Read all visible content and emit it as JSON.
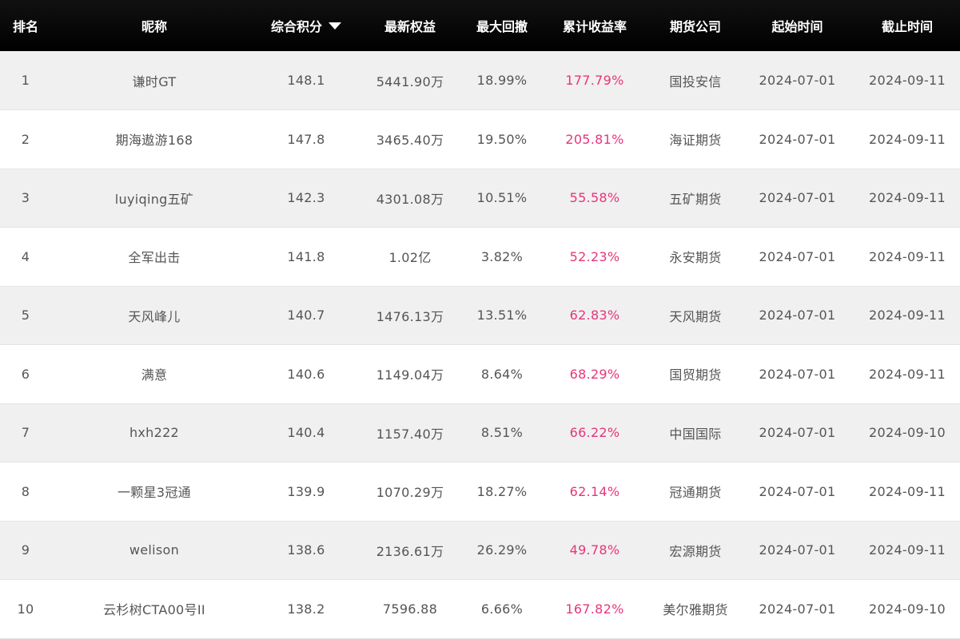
{
  "header": {
    "rank": "排名",
    "nickname": "昵称",
    "score": "综合积分",
    "equity": "最新权益",
    "drawdown": "最大回撤",
    "return": "累计收益率",
    "company": "期货公司",
    "start": "起始时间",
    "end": "截止时间"
  },
  "colors": {
    "header_bg": "#000000",
    "header_text": "#ffffff",
    "row_odd_bg": "#f0f0f0",
    "row_even_bg": "#ffffff",
    "text": "#555555",
    "return_text": "#e8357a"
  },
  "rows": [
    {
      "rank": "1",
      "nickname": "谦时GT",
      "score": "148.1",
      "equity": "5441.90万",
      "drawdown": "18.99%",
      "return": "177.79%",
      "company": "国投安信",
      "start": "2024-07-01",
      "end": "2024-09-11"
    },
    {
      "rank": "2",
      "nickname": "期海遨游168",
      "score": "147.8",
      "equity": "3465.40万",
      "drawdown": "19.50%",
      "return": "205.81%",
      "company": "海证期货",
      "start": "2024-07-01",
      "end": "2024-09-11"
    },
    {
      "rank": "3",
      "nickname": "luyiqing五矿",
      "score": "142.3",
      "equity": "4301.08万",
      "drawdown": "10.51%",
      "return": "55.58%",
      "company": "五矿期货",
      "start": "2024-07-01",
      "end": "2024-09-11"
    },
    {
      "rank": "4",
      "nickname": "全军出击",
      "score": "141.8",
      "equity": "1.02亿",
      "drawdown": "3.82%",
      "return": "52.23%",
      "company": "永安期货",
      "start": "2024-07-01",
      "end": "2024-09-11"
    },
    {
      "rank": "5",
      "nickname": "天风峰儿",
      "score": "140.7",
      "equity": "1476.13万",
      "drawdown": "13.51%",
      "return": "62.83%",
      "company": "天风期货",
      "start": "2024-07-01",
      "end": "2024-09-11"
    },
    {
      "rank": "6",
      "nickname": "满意",
      "score": "140.6",
      "equity": "1149.04万",
      "drawdown": "8.64%",
      "return": "68.29%",
      "company": "国贸期货",
      "start": "2024-07-01",
      "end": "2024-09-11"
    },
    {
      "rank": "7",
      "nickname": "hxh222",
      "score": "140.4",
      "equity": "1157.40万",
      "drawdown": "8.51%",
      "return": "66.22%",
      "company": "中国国际",
      "start": "2024-07-01",
      "end": "2024-09-10"
    },
    {
      "rank": "8",
      "nickname": "一颗星3冠通",
      "score": "139.9",
      "equity": "1070.29万",
      "drawdown": "18.27%",
      "return": "62.14%",
      "company": "冠通期货",
      "start": "2024-07-01",
      "end": "2024-09-11"
    },
    {
      "rank": "9",
      "nickname": "welison",
      "score": "138.6",
      "equity": "2136.61万",
      "drawdown": "26.29%",
      "return": "49.78%",
      "company": "宏源期货",
      "start": "2024-07-01",
      "end": "2024-09-11"
    },
    {
      "rank": "10",
      "nickname": "云杉树CTA00号II",
      "score": "138.2",
      "equity": "7596.88",
      "drawdown": "6.66%",
      "return": "167.82%",
      "company": "美尔雅期货",
      "start": "2024-07-01",
      "end": "2024-09-10"
    }
  ]
}
